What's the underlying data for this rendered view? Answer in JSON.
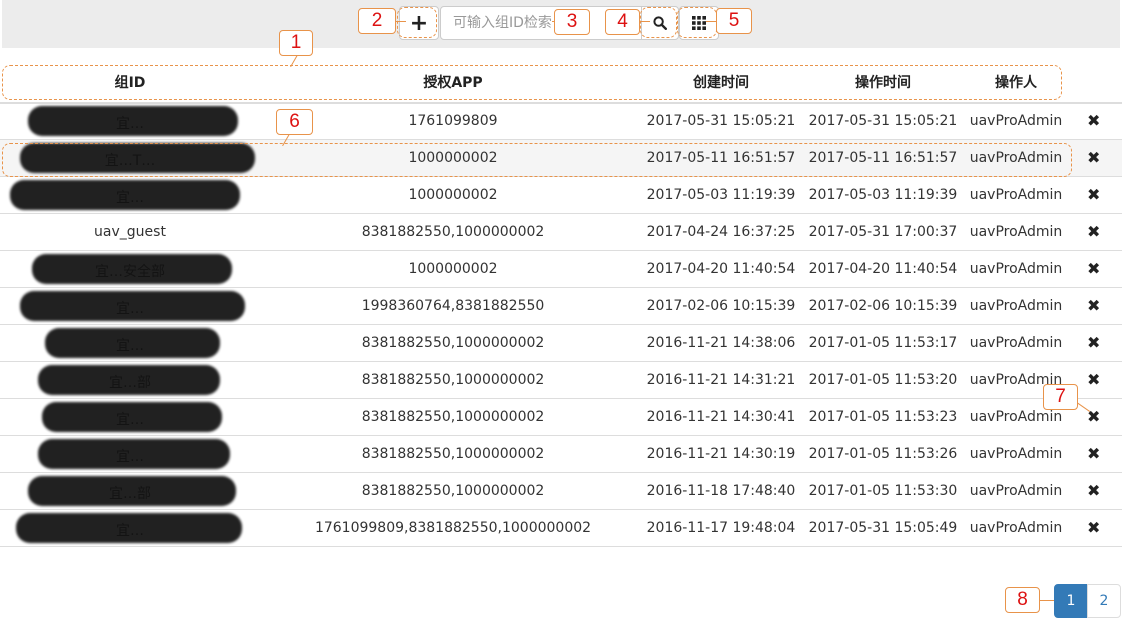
{
  "toolbar": {
    "add_icon": "plus-icon",
    "search_placeholder": "可输入组ID检索",
    "search_value": "",
    "search_icon": "magnifier-icon",
    "grid_icon": "grid-icon"
  },
  "table": {
    "headers": [
      "组ID",
      "授权APP",
      "创建时间",
      "操作时间",
      "操作人"
    ],
    "rows": [
      {
        "group_id": "宜…",
        "apps": "1761099809",
        "created": "2017-05-31 15:05:21",
        "updated": "2017-05-31 15:05:21",
        "operator": "uavProAdmin"
      },
      {
        "group_id": "宜…T…",
        "apps": "1000000002",
        "created": "2017-05-11 16:51:57",
        "updated": "2017-05-11 16:51:57",
        "operator": "uavProAdmin"
      },
      {
        "group_id": "宜…",
        "apps": "1000000002",
        "created": "2017-05-03 11:19:39",
        "updated": "2017-05-03 11:19:39",
        "operator": "uavProAdmin"
      },
      {
        "group_id": "uav_guest",
        "apps": "8381882550,1000000002",
        "created": "2017-04-24 16:37:25",
        "updated": "2017-05-31 17:00:37",
        "operator": "uavProAdmin"
      },
      {
        "group_id": "宜…安全部",
        "apps": "1000000002",
        "created": "2017-04-20 11:40:54",
        "updated": "2017-04-20 11:40:54",
        "operator": "uavProAdmin"
      },
      {
        "group_id": "宜…",
        "apps": "1998360764,8381882550",
        "created": "2017-02-06 10:15:39",
        "updated": "2017-02-06 10:15:39",
        "operator": "uavProAdmin"
      },
      {
        "group_id": "宜…",
        "apps": "8381882550,1000000002",
        "created": "2016-11-21 14:38:06",
        "updated": "2017-01-05 11:53:17",
        "operator": "uavProAdmin"
      },
      {
        "group_id": "宜…部",
        "apps": "8381882550,1000000002",
        "created": "2016-11-21 14:31:21",
        "updated": "2017-01-05 11:53:20",
        "operator": "uavProAdmin"
      },
      {
        "group_id": "宜…",
        "apps": "8381882550,1000000002",
        "created": "2016-11-21 14:30:41",
        "updated": "2017-01-05 11:53:23",
        "operator": "uavProAdmin"
      },
      {
        "group_id": "宜…",
        "apps": "8381882550,1000000002",
        "created": "2016-11-21 14:30:19",
        "updated": "2017-01-05 11:53:26",
        "operator": "uavProAdmin"
      },
      {
        "group_id": "宜…部",
        "apps": "8381882550,1000000002",
        "created": "2016-11-18 17:48:40",
        "updated": "2017-01-05 11:53:30",
        "operator": "uavProAdmin"
      },
      {
        "group_id": "宜…",
        "apps": "1761099809,8381882550,1000000002",
        "created": "2016-11-17 19:48:04",
        "updated": "2017-05-31 15:05:49",
        "operator": "uavProAdmin"
      }
    ],
    "delete_icon": "close-x-icon",
    "hover_row": 2
  },
  "pagination": {
    "pages": [
      "1",
      "2"
    ],
    "active_page": "1"
  },
  "annotations": [
    "1",
    "2",
    "3",
    "4",
    "5",
    "6",
    "7",
    "8"
  ],
  "colors": {
    "accent": "#337ab7",
    "annotation_border": "#e8934a",
    "annotation_text": "#dd1111",
    "toolbar_bg": "#ececec"
  }
}
